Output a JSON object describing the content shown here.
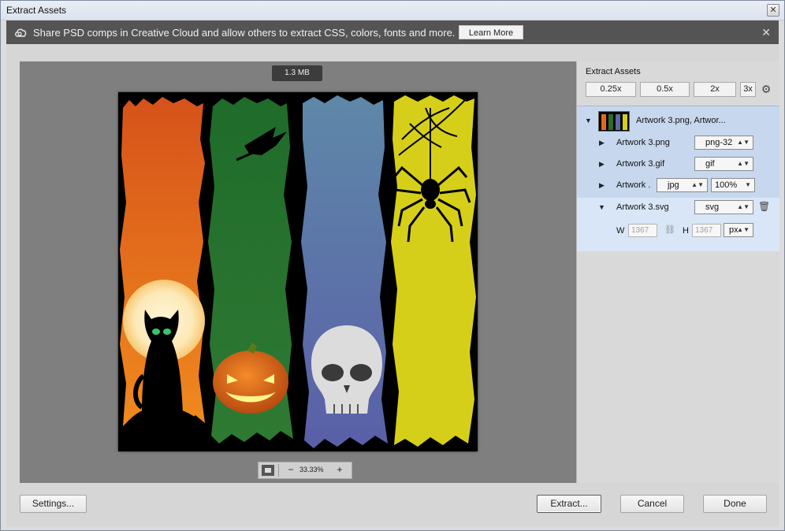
{
  "window": {
    "title": "Extract Assets",
    "close_glyph": "✕"
  },
  "banner": {
    "icon": "creative-cloud-icon",
    "message": "Share PSD comps in Creative Cloud and allow others to extract CSS, colors, fonts and more.",
    "learn_more": "Learn More",
    "close_glyph": "✕"
  },
  "preview": {
    "file_size": "1.3 MB",
    "zoom_level": "33.33%",
    "zoom_out": "−",
    "zoom_in": "+"
  },
  "sidebar": {
    "header": "Extract Assets",
    "scales": [
      "0.25x",
      "0.5x",
      "2x",
      "3x"
    ],
    "gear_glyph": "⚙",
    "group_title": "Artwork 3.png, Artwor...",
    "assets": [
      {
        "name": "Artwork 3.png",
        "format": "png-32"
      },
      {
        "name": "Artwork 3.gif",
        "format": "gif"
      },
      {
        "name": "Artwork .",
        "format": "jpg",
        "quality": "100%"
      },
      {
        "name": "Artwork 3.svg",
        "format": "svg"
      }
    ],
    "svg_size": {
      "w_label": "W",
      "w_value": "1367",
      "h_label": "H",
      "h_value": "1367",
      "unit": "px"
    }
  },
  "footer": {
    "settings": "Settings...",
    "extract": "Extract...",
    "cancel": "Cancel",
    "done": "Done"
  },
  "colors": {
    "banner_bg": "#545454",
    "preview_bg": "#7f7f7f",
    "selection_bg": "#c7d8ee",
    "orange": "#e8661b",
    "green": "#2a6e2a",
    "blue": "#5a6ba8",
    "yellow": "#d6cf1a"
  }
}
